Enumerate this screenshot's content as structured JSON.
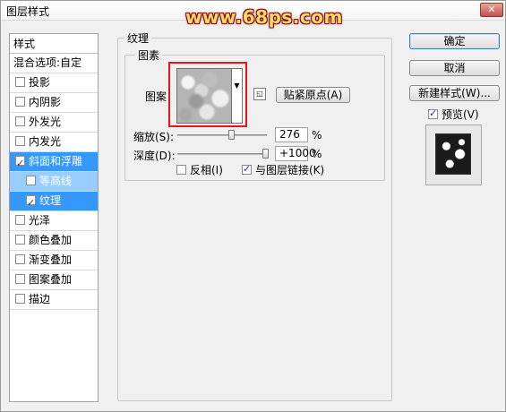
{
  "window": {
    "title": "图层样式",
    "close_glyph": "✕"
  },
  "watermark": "www.68ps.com",
  "style_list": {
    "header": "样式",
    "blend_options": "混合选项:自定",
    "items": [
      {
        "label": "投影",
        "checked": false
      },
      {
        "label": "内阴影",
        "checked": false
      },
      {
        "label": "外发光",
        "checked": false
      },
      {
        "label": "内发光",
        "checked": false
      },
      {
        "label": "斜面和浮雕",
        "checked": true
      },
      {
        "label": "等高线",
        "checked": false
      },
      {
        "label": "纹理",
        "checked": true
      },
      {
        "label": "光泽",
        "checked": false
      },
      {
        "label": "颜色叠加",
        "checked": false
      },
      {
        "label": "渐变叠加",
        "checked": false
      },
      {
        "label": "图案叠加",
        "checked": false
      },
      {
        "label": "描边",
        "checked": false
      }
    ]
  },
  "texture": {
    "group_title": "纹理",
    "element_title": "图素",
    "pattern_label": "图案",
    "snap_button": "贴紧原点(A)",
    "scale_label": "缩放(S):",
    "scale_value": "276",
    "scale_unit": "%",
    "depth_label": "深度(D):",
    "depth_value": "+1000",
    "depth_unit": "%",
    "invert_label": "反相(I)",
    "invert_checked": false,
    "link_label": "与图层链接(K)",
    "link_checked": true
  },
  "actions": {
    "ok": "确定",
    "cancel": "取消",
    "new_style": "新建样式(W)...",
    "preview_label": "预览(V)",
    "preview_checked": true
  },
  "colors": {
    "selected_row": "#3399ff",
    "sub_selected_row": "#99ccff",
    "highlight_frame": "#e5151a"
  }
}
